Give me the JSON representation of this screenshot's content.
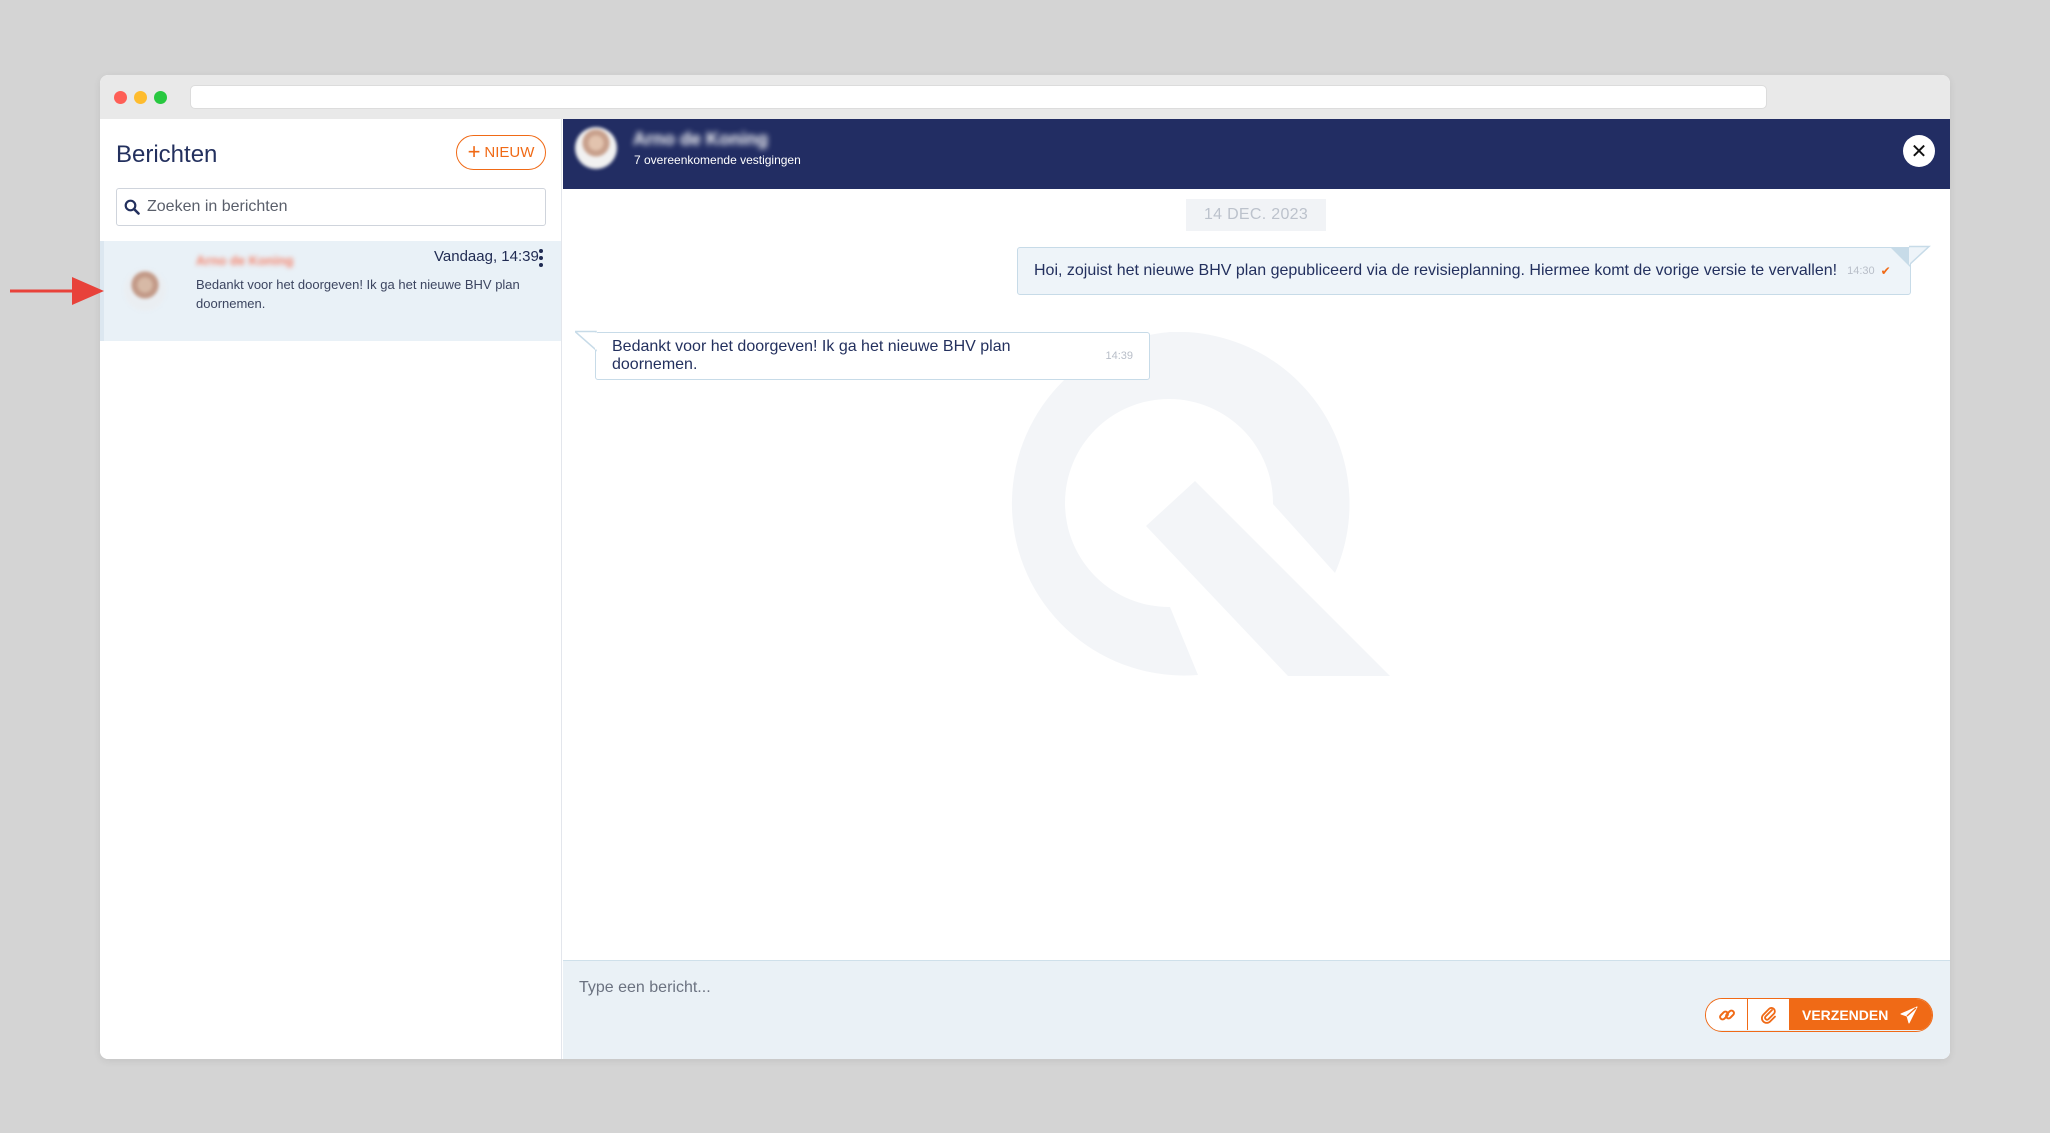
{
  "sidebar": {
    "title": "Berichten",
    "new_button": "NIEUW",
    "search_placeholder": "Zoeken in berichten",
    "conversations": [
      {
        "name": "Arno de Koning",
        "time": "Vandaag, 14:39",
        "preview": "Bedankt voor het doorgeven! Ik ga het nieuwe BHV plan doornemen."
      }
    ]
  },
  "chat": {
    "contact_name": "Arno de Koning",
    "contact_sub": "7 overeenkomende vestigingen",
    "close_icon": "close-icon",
    "date_chip": "14 DEC. 2023",
    "messages": [
      {
        "direction": "out",
        "text": "Hoi, zojuist het nieuwe BHV plan gepubliceerd via de revisieplanning. Hiermee komt de vorige versie te vervallen!",
        "time": "14:30",
        "status_icon": "double-check-icon"
      },
      {
        "direction": "in",
        "text": "Bedankt voor het doorgeven! Ik ga het nieuwe BHV plan doornemen.",
        "time": "14:39"
      }
    ],
    "composer_placeholder": "Type een bericht...",
    "send_label": "VERZENDEN",
    "link_icon": "link-icon",
    "attach_icon": "paperclip-icon",
    "send_icon": "paper-plane-icon"
  },
  "colors": {
    "header": "#222d63",
    "accent": "#f06a16",
    "annotation_arrow": "#e8423a"
  }
}
